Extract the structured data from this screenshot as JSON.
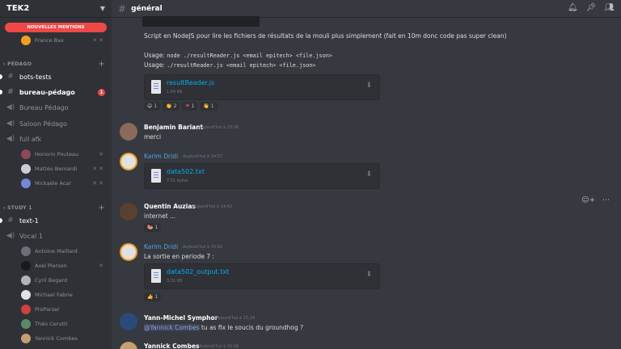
{
  "guild": {
    "name": "TEK2"
  },
  "sidebar": {
    "mentions_label": "NOUVELLES MENTIONS",
    "top_user": "France Bax",
    "categories": [
      {
        "name": "PÉDAGO"
      },
      {
        "name": "STUDY 1"
      }
    ],
    "channels": [
      {
        "label": "bots-tests",
        "type": "text"
      },
      {
        "label": "bureau-pédago",
        "type": "text",
        "badge": "1"
      },
      {
        "label": "Bureau Pédago",
        "type": "voice"
      },
      {
        "label": "Saloon Pédago",
        "type": "voice"
      },
      {
        "label": "full afk",
        "type": "voice"
      },
      {
        "label": "text-1",
        "type": "text"
      },
      {
        "label": "Vocal 1",
        "type": "voice"
      }
    ],
    "voice_users_afk": [
      {
        "name": "Honorin Pouteau"
      },
      {
        "name": "Mattéo Bernardi"
      },
      {
        "name": "Mickaële Acar"
      }
    ],
    "voice_users_vocal": [
      {
        "name": "Antoine Maillard"
      },
      {
        "name": "Axel Pierson"
      },
      {
        "name": "Cyril Begard"
      },
      {
        "name": "Michael Fabrie"
      },
      {
        "name": "ProParser"
      },
      {
        "name": "Théo Cerutti"
      },
      {
        "name": "Yannick Combes"
      }
    ]
  },
  "channel": {
    "name": "général"
  },
  "messages": {
    "m0": {
      "text": "Script en NodeJS pour lire les fichiers de résultats de  la mouli plus simplement (fait en 10m donc code pas super clean)",
      "usage1_label": "Usage:",
      "usage1_code": "node ./resultReader.js <email epitech> <file.json>",
      "usage2_label": "Usage:",
      "usage2_code": "./resultReader.js <email epitech> <file.json>",
      "file": {
        "name": "resultReader.js",
        "size": "1.64 KB"
      },
      "reactions": [
        {
          "emoji": "😄",
          "count": "1"
        },
        {
          "emoji": "👏",
          "count": "2"
        },
        {
          "emoji": "❤",
          "count": "1"
        },
        {
          "emoji": "👋",
          "count": "1"
        }
      ]
    },
    "m1": {
      "author": "Benjamin Bariant",
      "time": "Aujourd'hui à 13:36",
      "text": "merci"
    },
    "m2": {
      "author": "Karim Dridi",
      "time": "Aujourd'hui à 14:37",
      "file": {
        "name": "data502.txt",
        "size": "7.51 bytes"
      }
    },
    "m3": {
      "author": "Quentin Auzias",
      "time": "Aujourd'hui à 14:42",
      "text": "internet ...",
      "reactions": [
        {
          "emoji": "🍉",
          "count": "1"
        }
      ]
    },
    "m4": {
      "author": "Karim Dridi",
      "time": "Aujourd'hui à 15:01",
      "text": "La sortie en periode 7 :",
      "file": {
        "name": "data502_output.txt",
        "size": "3.31 KB"
      },
      "reactions": [
        {
          "emoji": "👍",
          "count": "1"
        }
      ]
    },
    "m5": {
      "author": "Yann-Michel Symphor",
      "time": "Aujourd'hui à 15:14",
      "mention": "@Yannick Combes",
      "text": " tu as fix le soucis du groundhog ?"
    },
    "m6": {
      "author": "Yannick Combes",
      "time": "Aujourd'hui à 15:18"
    }
  },
  "colors": {
    "mention_red": "#f04747",
    "link": "#00b0f4",
    "blurple": "#7289da"
  }
}
